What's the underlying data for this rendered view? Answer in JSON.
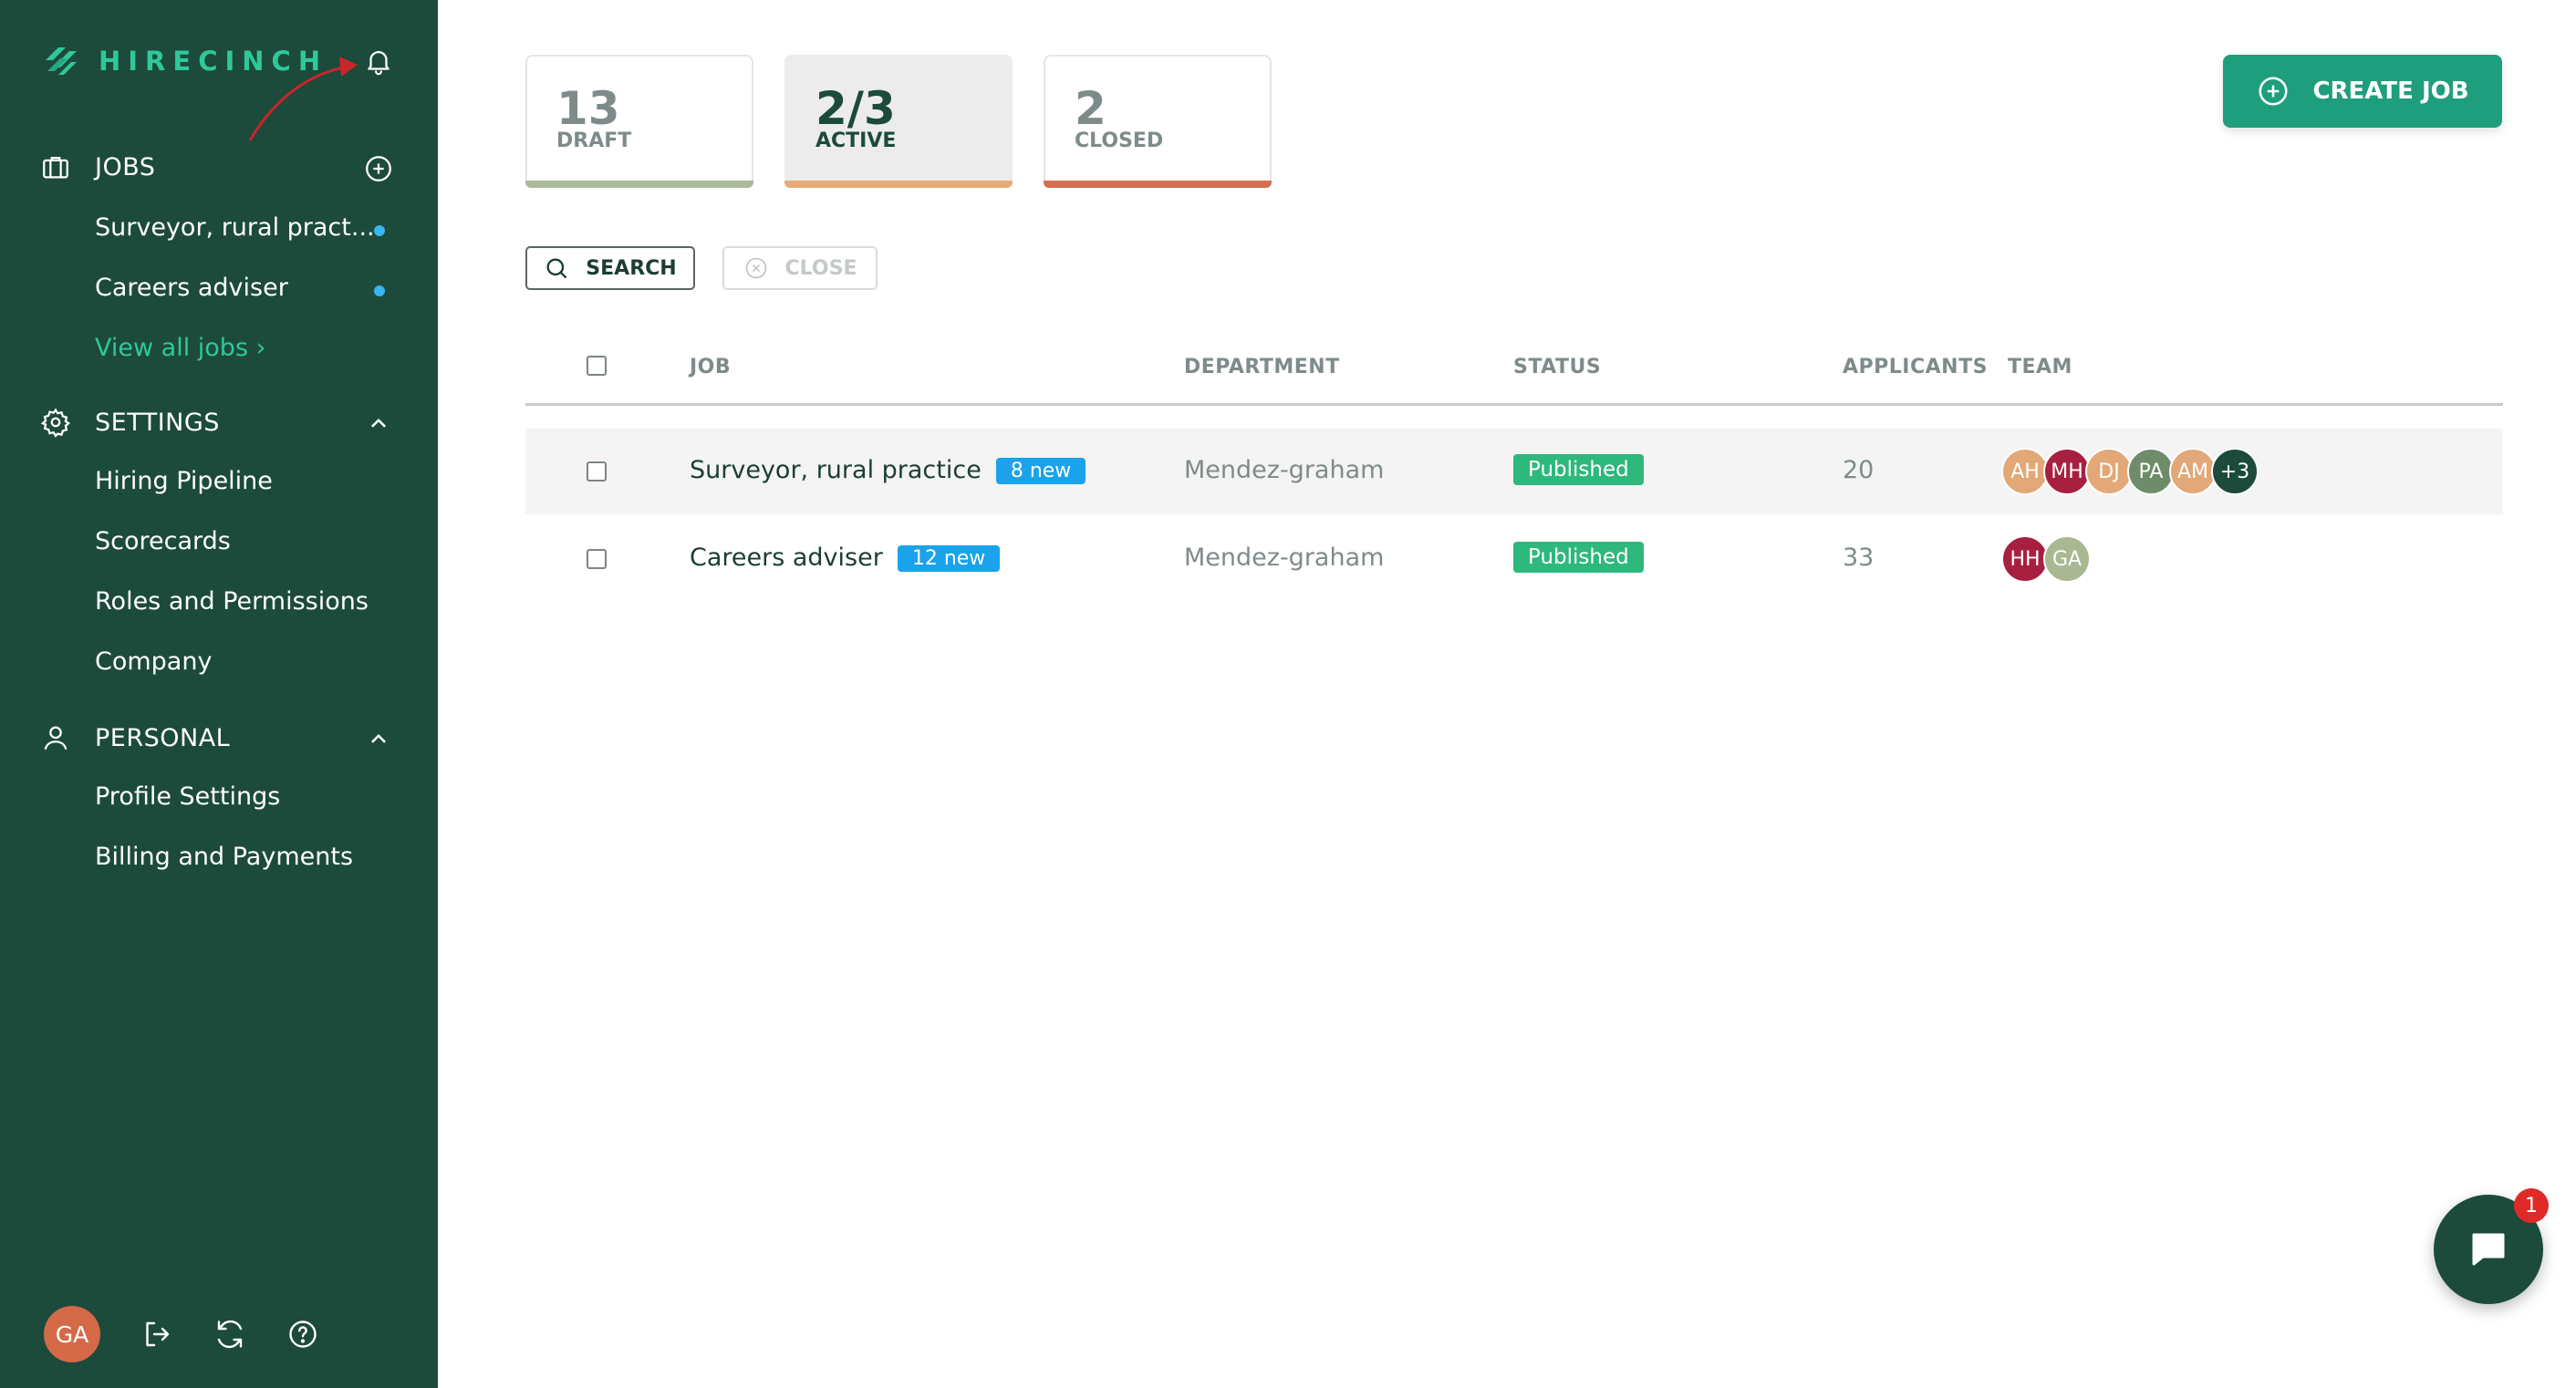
{
  "brand": {
    "name": "HIRECINCH"
  },
  "nav": {
    "jobs": {
      "label": "JOBS",
      "items": [
        {
          "label": "Surveyor, rural pract..."
        },
        {
          "label": "Careers adviser"
        }
      ],
      "view_all": "View all jobs ›"
    },
    "settings": {
      "label": "SETTINGS",
      "items": [
        "Hiring Pipeline",
        "Scorecards",
        "Roles and Permissions",
        "Company"
      ]
    },
    "personal": {
      "label": "PERSONAL",
      "items": [
        "Profile Settings",
        "Billing and Payments"
      ]
    }
  },
  "user": {
    "initials": "GA"
  },
  "stats": [
    {
      "value": "13",
      "label": "DRAFT",
      "bar_color": "#a9bb9b"
    },
    {
      "value": "2/3",
      "label": "ACTIVE",
      "bar_color": "#e8ab77"
    },
    {
      "value": "2",
      "label": "CLOSED",
      "bar_color": "#d4704f"
    }
  ],
  "actions": {
    "create_job": "CREATE JOB",
    "search": "SEARCH",
    "close": "CLOSE"
  },
  "table": {
    "columns": {
      "job": "JOB",
      "department": "DEPARTMENT",
      "status": "STATUS",
      "applicants": "APPLICANTS",
      "team": "TEAM"
    },
    "rows": [
      {
        "title": "Surveyor, rural practice",
        "new_badge": "8 new",
        "department": "Mendez-graham",
        "status": "Published",
        "applicants": "20",
        "team": [
          {
            "initials": "AH",
            "color": "#e2a877"
          },
          {
            "initials": "MH",
            "color": "#a8203f"
          },
          {
            "initials": "DJ",
            "color": "#e2a877"
          },
          {
            "initials": "PA",
            "color": "#6f8c6a"
          },
          {
            "initials": "AM",
            "color": "#e2a877"
          },
          {
            "initials": "+3",
            "color": "#1c4a3b"
          }
        ]
      },
      {
        "title": "Careers adviser",
        "new_badge": "12 new",
        "department": "Mendez-graham",
        "status": "Published",
        "applicants": "33",
        "team": [
          {
            "initials": "HH",
            "color": "#a8203f"
          },
          {
            "initials": "GA",
            "color": "#a9b892"
          }
        ]
      }
    ]
  },
  "chat": {
    "unread": "1"
  }
}
